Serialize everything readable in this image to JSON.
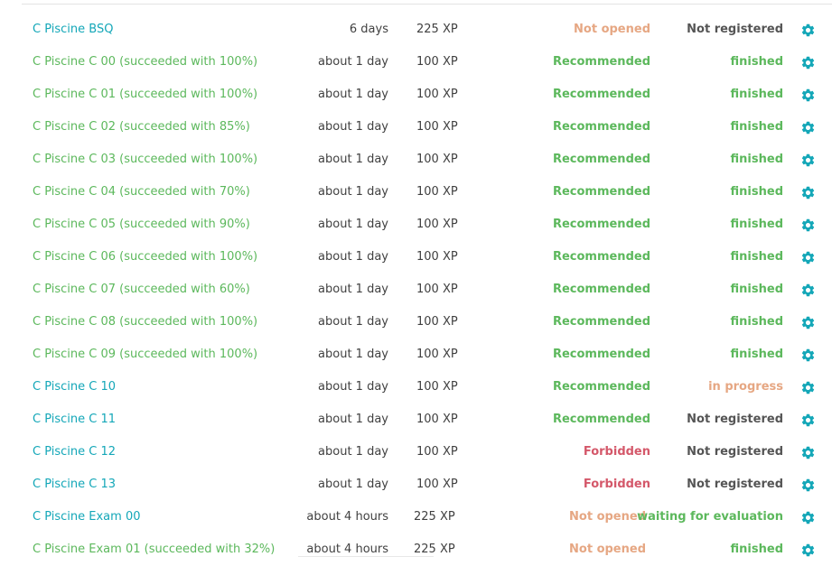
{
  "colors": {
    "teal": "#14a7b8",
    "green": "#5cb85c",
    "orange": "#e6a783",
    "red": "#d4586a",
    "grey": "#555555"
  },
  "projects": [
    {
      "name": "C Piscine BSQ",
      "name_color": "teal",
      "duration": "6 days",
      "xp": "225 XP",
      "recommendation": "Not opened",
      "rec_color": "orange",
      "status": "Not registered",
      "status_color": "grey",
      "icon": "gear-icon"
    },
    {
      "name": "C Piscine C 00 (succeeded with 100%)",
      "name_color": "green",
      "duration": "about 1 day",
      "xp": "100 XP",
      "recommendation": "Recommended",
      "rec_color": "green",
      "status": "finished",
      "status_color": "green",
      "icon": "gear-icon"
    },
    {
      "name": "C Piscine C 01 (succeeded with 100%)",
      "name_color": "green",
      "duration": "about 1 day",
      "xp": "100 XP",
      "recommendation": "Recommended",
      "rec_color": "green",
      "status": "finished",
      "status_color": "green",
      "icon": "gear-icon"
    },
    {
      "name": "C Piscine C 02 (succeeded with 85%)",
      "name_color": "green",
      "duration": "about 1 day",
      "xp": "100 XP",
      "recommendation": "Recommended",
      "rec_color": "green",
      "status": "finished",
      "status_color": "green",
      "icon": "gear-icon"
    },
    {
      "name": "C Piscine C 03 (succeeded with 100%)",
      "name_color": "green",
      "duration": "about 1 day",
      "xp": "100 XP",
      "recommendation": "Recommended",
      "rec_color": "green",
      "status": "finished",
      "status_color": "green",
      "icon": "gear-icon"
    },
    {
      "name": "C Piscine C 04 (succeeded with 70%)",
      "name_color": "green",
      "duration": "about 1 day",
      "xp": "100 XP",
      "recommendation": "Recommended",
      "rec_color": "green",
      "status": "finished",
      "status_color": "green",
      "icon": "gear-icon"
    },
    {
      "name": "C Piscine C 05 (succeeded with 90%)",
      "name_color": "green",
      "duration": "about 1 day",
      "xp": "100 XP",
      "recommendation": "Recommended",
      "rec_color": "green",
      "status": "finished",
      "status_color": "green",
      "icon": "gear-icon"
    },
    {
      "name": "C Piscine C 06 (succeeded with 100%)",
      "name_color": "green",
      "duration": "about 1 day",
      "xp": "100 XP",
      "recommendation": "Recommended",
      "rec_color": "green",
      "status": "finished",
      "status_color": "green",
      "icon": "gear-icon"
    },
    {
      "name": "C Piscine C 07 (succeeded with 60%)",
      "name_color": "green",
      "duration": "about 1 day",
      "xp": "100 XP",
      "recommendation": "Recommended",
      "rec_color": "green",
      "status": "finished",
      "status_color": "green",
      "icon": "gear-icon"
    },
    {
      "name": "C Piscine C 08 (succeeded with 100%)",
      "name_color": "green",
      "duration": "about 1 day",
      "xp": "100 XP",
      "recommendation": "Recommended",
      "rec_color": "green",
      "status": "finished",
      "status_color": "green",
      "icon": "gear-icon"
    },
    {
      "name": "C Piscine C 09 (succeeded with 100%)",
      "name_color": "green",
      "duration": "about 1 day",
      "xp": "100 XP",
      "recommendation": "Recommended",
      "rec_color": "green",
      "status": "finished",
      "status_color": "green",
      "icon": "gear-icon"
    },
    {
      "name": "C Piscine C 10",
      "name_color": "teal",
      "duration": "about 1 day",
      "xp": "100 XP",
      "recommendation": "Recommended",
      "rec_color": "green",
      "status": "in progress",
      "status_color": "orange",
      "icon": "gear-icon"
    },
    {
      "name": "C Piscine C 11",
      "name_color": "teal",
      "duration": "about 1 day",
      "xp": "100 XP",
      "recommendation": "Recommended",
      "rec_color": "green",
      "status": "Not registered",
      "status_color": "grey",
      "icon": "gear-icon"
    },
    {
      "name": "C Piscine C 12",
      "name_color": "teal",
      "duration": "about 1 day",
      "xp": "100 XP",
      "recommendation": "Forbidden",
      "rec_color": "red",
      "status": "Not registered",
      "status_color": "grey",
      "icon": "gear-icon"
    },
    {
      "name": "C Piscine C 13",
      "name_color": "teal",
      "duration": "about 1 day",
      "xp": "100 XP",
      "recommendation": "Forbidden",
      "rec_color": "red",
      "status": "Not registered",
      "status_color": "grey",
      "icon": "gear-icon"
    },
    {
      "name": "C Piscine Exam 00",
      "name_color": "teal",
      "duration": "about 4 hours",
      "xp": "225 XP",
      "recommendation": "Not opened",
      "rec_color": "orange",
      "status": "waiting for evaluation",
      "status_color": "green",
      "icon": "gear-icon",
      "exam": true
    },
    {
      "name": "C Piscine Exam 01 (succeeded with 32%)",
      "name_color": "green",
      "duration": "about 4 hours",
      "xp": "225 XP",
      "recommendation": "Not opened",
      "rec_color": "orange",
      "status": "finished",
      "status_color": "green",
      "icon": "gear-icon",
      "exam": true
    }
  ]
}
